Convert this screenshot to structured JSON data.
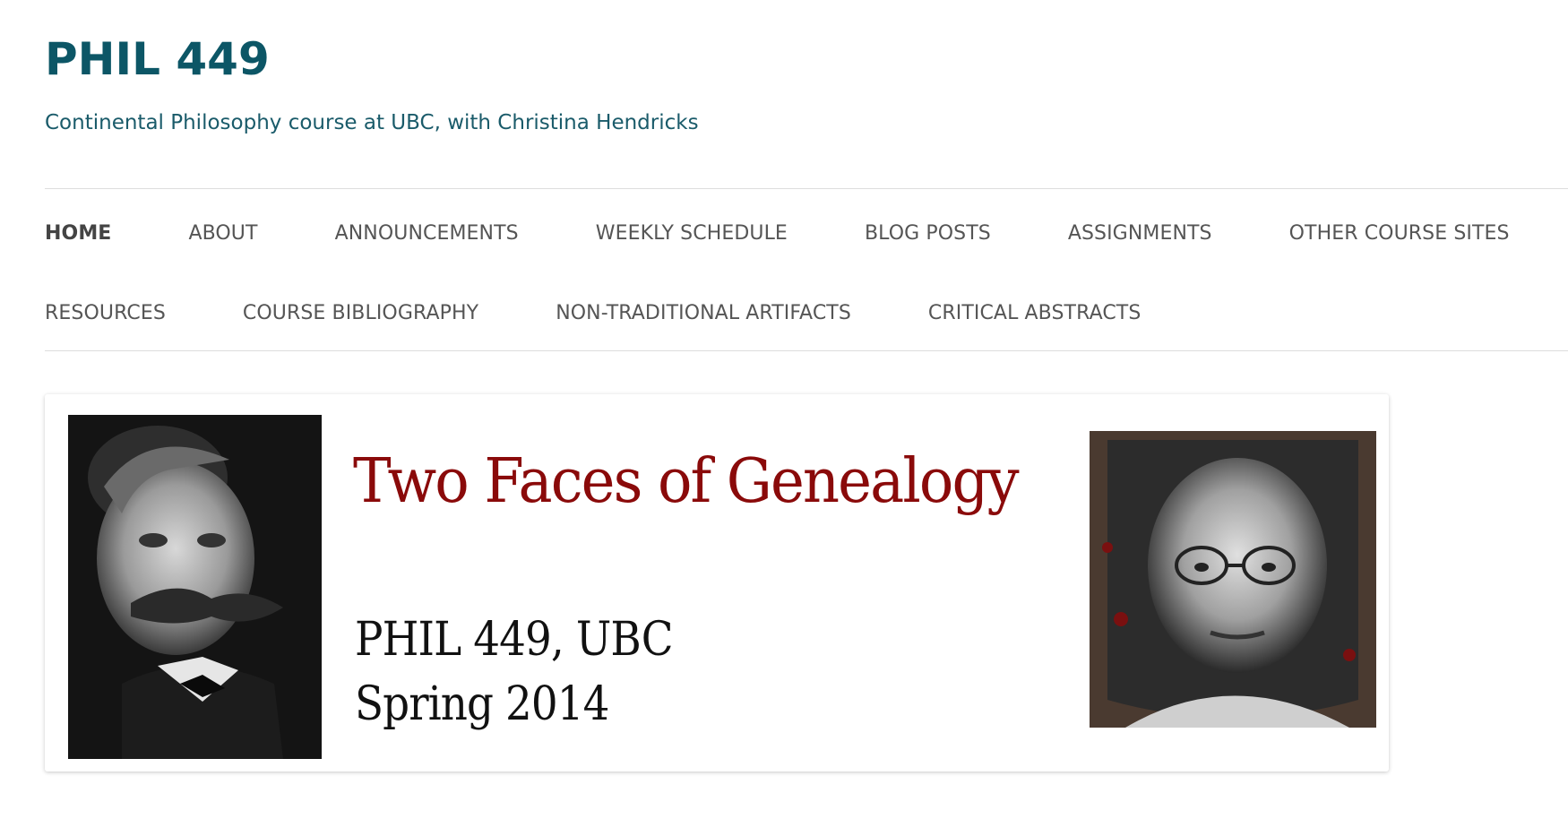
{
  "site": {
    "title": "PHIL 449",
    "description": "Continental Philosophy course at UBC, with Christina Hendricks"
  },
  "nav": {
    "row1": [
      "HOME",
      "ABOUT",
      "ANNOUNCEMENTS",
      "WEEKLY SCHEDULE",
      "BLOG POSTS",
      "ASSIGNMENTS",
      "OTHER COURSE SITES"
    ],
    "row2": [
      "RESOURCES",
      "COURSE BIBLIOGRAPHY",
      "NON-TRADITIONAL ARTIFACTS",
      "CRITICAL ABSTRACTS"
    ],
    "active": "HOME"
  },
  "banner": {
    "title": "Two Faces of Genealogy",
    "subtitle_line1": "PHIL 449, UBC",
    "subtitle_line2": "Spring 2014"
  },
  "colors": {
    "site_title": "#0c5666",
    "banner_title": "#8a0a0a",
    "nav_text": "#555555"
  }
}
